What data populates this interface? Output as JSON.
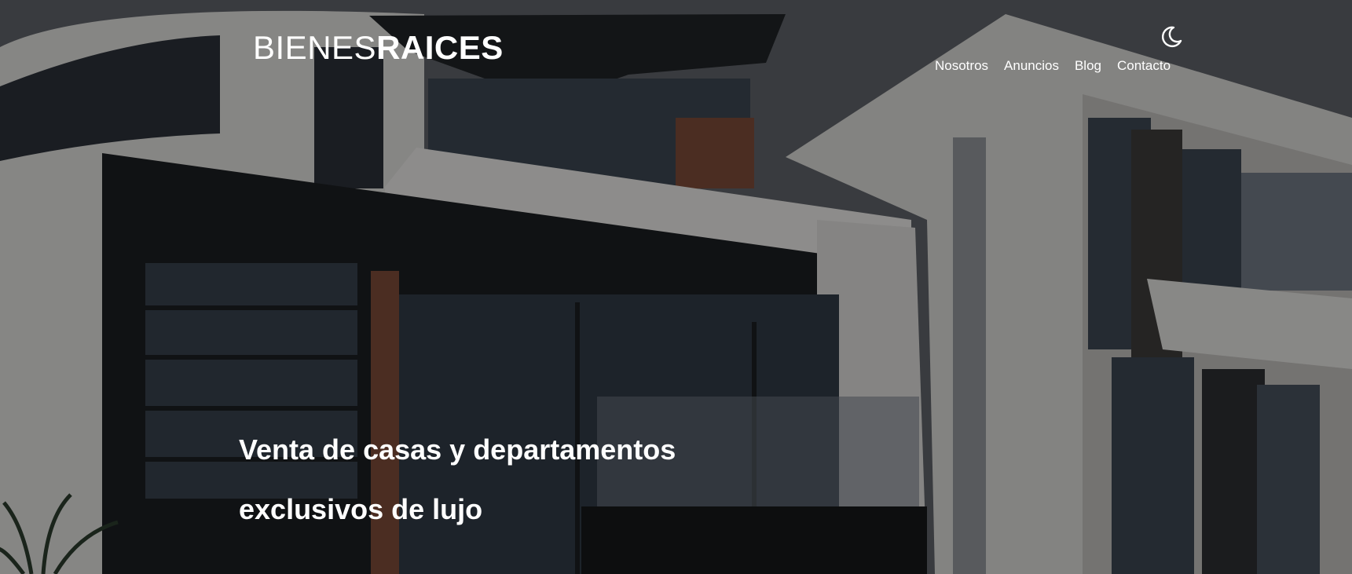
{
  "header": {
    "logo_light": "BIENES",
    "logo_bold": "RAICES",
    "theme_toggle_icon": "moon-icon",
    "nav": [
      {
        "label": "Nosotros"
      },
      {
        "label": "Anuncios"
      },
      {
        "label": "Blog"
      },
      {
        "label": "Contacto"
      }
    ]
  },
  "hero": {
    "headline": "Venta de casas y departamentos exclusivos de lujo",
    "background": "modern-house-photo"
  },
  "colors": {
    "text": "#ffffff",
    "overlay": "#000000"
  }
}
